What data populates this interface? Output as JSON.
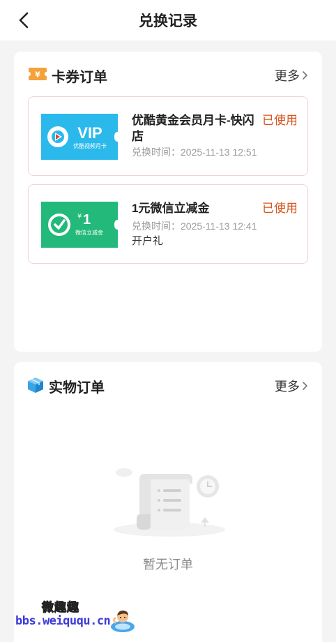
{
  "header": {
    "title": "兑换记录"
  },
  "voucher_section": {
    "title": "卡券订单",
    "more_label": "更多",
    "items": [
      {
        "name": "优酷黄金会员月卡-快闪店",
        "status": "已使用",
        "time": "兑换时间：2025-11-13 12:51",
        "thumb_big": "VIP",
        "thumb_small": "优酷视频月卡",
        "thumb_color": "#2bb9ec"
      },
      {
        "name": "1元微信立减金",
        "status": "已使用",
        "time": "兑换时间：2025-11-13 12:41",
        "extra": "开户礼",
        "thumb_big": "1",
        "thumb_currency": "¥",
        "thumb_small": "微信立减金",
        "thumb_color": "#22b97a"
      }
    ]
  },
  "physical_section": {
    "title": "实物订单",
    "more_label": "更多",
    "empty_text": "暂无订单"
  },
  "watermark": {
    "line1": "微趣趣",
    "line2": "bbs.weiququ.cn"
  },
  "colors": {
    "status": "#d8541c",
    "item_border": "#f3d2d2",
    "accent_orange": "#f5a13a"
  }
}
